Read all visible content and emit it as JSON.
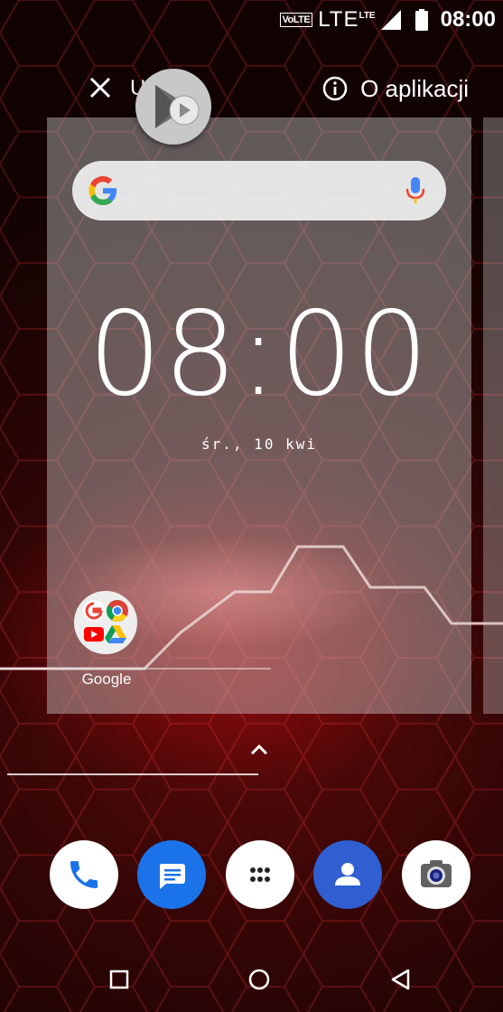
{
  "status_bar": {
    "volte": "VoLTE",
    "network": "LTE",
    "network_small": "LTE",
    "time": "08:00",
    "icons": [
      "signal-icon",
      "battery-icon"
    ]
  },
  "recents": {
    "close_label": "U",
    "info_label": "O aplikacji",
    "icons": [
      "close-icon",
      "info-icon",
      "play-store-icon"
    ]
  },
  "card": {
    "search_icons": [
      "google-g-icon",
      "mic-icon"
    ],
    "clock": "08:00",
    "date": "śr., 10 kwi",
    "folder_label": "Google",
    "folder_icons": [
      "google-g-icon",
      "chrome-icon",
      "youtube-icon",
      "drive-icon"
    ]
  },
  "drawer": {
    "icon": "chevron-up-icon"
  },
  "dock": {
    "apps": [
      "phone-icon",
      "messages-icon",
      "app-drawer-icon",
      "contacts-icon",
      "camera-icon"
    ],
    "colors": {
      "messages": "#1a73e8",
      "contacts": "#2f5fd0"
    }
  },
  "nav": {
    "icons": [
      "recents-square-icon",
      "home-circle-icon",
      "back-triangle-icon"
    ]
  }
}
